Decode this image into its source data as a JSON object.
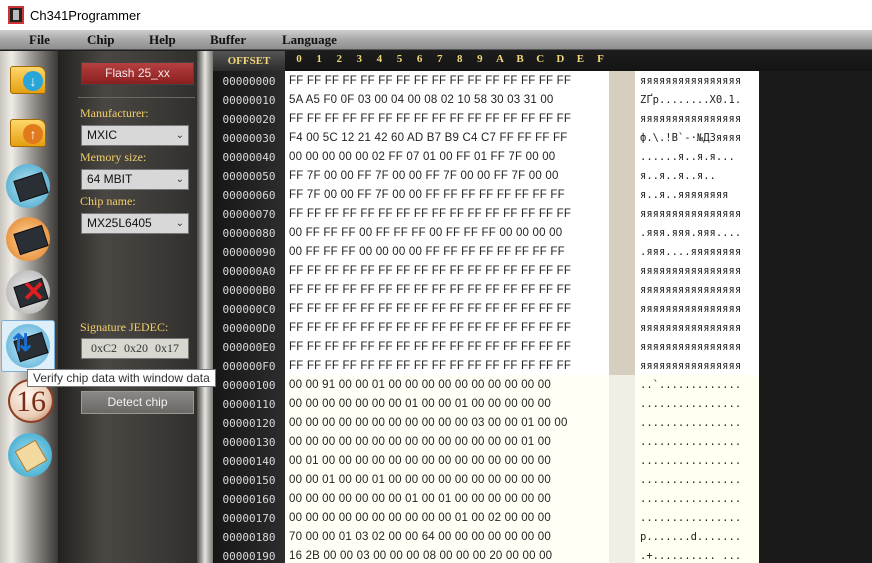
{
  "window": {
    "title": "Ch341Programmer"
  },
  "menu": [
    "File",
    "Chip",
    "Help",
    "Buffer",
    "Language"
  ],
  "rail": {
    "items": [
      {
        "name": "open-file-icon"
      },
      {
        "name": "save-file-icon"
      },
      {
        "name": "read-chip-icon"
      },
      {
        "name": "write-chip-icon"
      },
      {
        "name": "erase-chip-icon"
      },
      {
        "name": "verify-chip-icon"
      },
      {
        "name": "hex-16-icon",
        "text": "16"
      },
      {
        "name": "scroll-icon"
      }
    ]
  },
  "panel": {
    "flash_button": "Flash 25_xx",
    "manufacturer_label": "Manufacturer:",
    "manufacturer_value": "MXIC",
    "memory_label": "Memory size:",
    "memory_value": "64 MBIT",
    "chip_label": "Chip name:",
    "chip_value": "MX25L6405",
    "signature_label": "Signature JEDEC:",
    "signature_value": "0xC2 0x20 0x17",
    "detect_button": "Detect chip"
  },
  "tooltip": "Verify chip data with window data",
  "hex": {
    "offset_header": "OFFSET",
    "columns": [
      "0",
      "1",
      "2",
      "3",
      "4",
      "5",
      "6",
      "7",
      "8",
      "9",
      "A",
      "B",
      "C",
      "D",
      "E",
      "F"
    ],
    "rows": [
      {
        "offset": "00000000",
        "bytes": "FF FF FF FF FF FF FF FF FF FF FF FF FF FF FF FF",
        "ascii": "яяяяяяяяяяяяяяяя"
      },
      {
        "offset": "00000010",
        "bytes": "5A A5 F0 0F 03 00 04 00 08 02 10 58 30 03 31 00",
        "ascii": "ZҐр........X0.1."
      },
      {
        "offset": "00000020",
        "bytes": "FF FF FF FF FF FF FF FF FF FF FF FF FF FF FF FF",
        "ascii": "яяяяяяяяяяяяяяяя"
      },
      {
        "offset": "00000030",
        "bytes": "F4 00 5C 12 21 42 60 AD B7 B9 C4 C7 FF FF FF FF",
        "ascii": "ф.\\.!B`-·№ДЗяяяя"
      },
      {
        "offset": "00000040",
        "bytes": "00 00 00 00 00 02 FF 07 01 00 FF 01 FF 7F 00 00",
        "ascii": "......я..я.я..."
      },
      {
        "offset": "00000050",
        "bytes": "FF 7F 00 00 FF 7F 00 00 FF 7F 00 00 FF 7F 00 00",
        "ascii": "я..я..я..я.."
      },
      {
        "offset": "00000060",
        "bytes": "FF 7F 00 00 FF 7F 00 00 FF FF FF FF FF FF FF FF",
        "ascii": "я..я..яяяяяяяя"
      },
      {
        "offset": "00000070",
        "bytes": "FF FF FF FF FF FF FF FF FF FF FF FF FF FF FF FF",
        "ascii": "яяяяяяяяяяяяяяяя"
      },
      {
        "offset": "00000080",
        "bytes": "00 FF FF FF 00 FF FF FF 00 FF FF FF 00 00 00 00",
        "ascii": ".яяя.яяя.яяя...."
      },
      {
        "offset": "00000090",
        "bytes": "00 FF FF FF 00 00 00 00 FF FF FF FF FF FF FF FF",
        "ascii": ".яяя....яяяяяяяя"
      },
      {
        "offset": "000000A0",
        "bytes": "FF FF FF FF FF FF FF FF FF FF FF FF FF FF FF FF",
        "ascii": "яяяяяяяяяяяяяяяя"
      },
      {
        "offset": "000000B0",
        "bytes": "FF FF FF FF FF FF FF FF FF FF FF FF FF FF FF FF",
        "ascii": "яяяяяяяяяяяяяяяя"
      },
      {
        "offset": "000000C0",
        "bytes": "FF FF FF FF FF FF FF FF FF FF FF FF FF FF FF FF",
        "ascii": "яяяяяяяяяяяяяяяя"
      },
      {
        "offset": "000000D0",
        "bytes": "FF FF FF FF FF FF FF FF FF FF FF FF FF FF FF FF",
        "ascii": "яяяяяяяяяяяяяяяя"
      },
      {
        "offset": "000000E0",
        "bytes": "FF FF FF FF FF FF FF FF FF FF FF FF FF FF FF FF",
        "ascii": "яяяяяяяяяяяяяяяя"
      },
      {
        "offset": "000000F0",
        "bytes": "FF FF FF FF FF FF FF FF FF FF FF FF FF FF FF FF",
        "ascii": "яяяяяяяяяяяяяяяя"
      },
      {
        "offset": "00000100",
        "bytes": "00 00 91 00 00 01 00 00 00 00 00 00 00 00 00 00",
        "ascii": "..`............."
      },
      {
        "offset": "00000110",
        "bytes": "00 00 00 00 00 00 00 01 00 00 01 00 00 00 00 00",
        "ascii": "................"
      },
      {
        "offset": "00000120",
        "bytes": "00 00 00 00 00 00 00 00 00 00 00 03 00 00 01 00 00",
        "ascii": "................"
      },
      {
        "offset": "00000130",
        "bytes": "00 00 00 00 00 00 00 00 00 00 00 00 00 00 01 00",
        "ascii": "................"
      },
      {
        "offset": "00000140",
        "bytes": "00 01 00 00 00 00 00 00 00 00 00 00 00 00 00 00",
        "ascii": "................"
      },
      {
        "offset": "00000150",
        "bytes": "00 00 01 00 00 01 00 00 00 00 00 00 00 00 00 00",
        "ascii": "................"
      },
      {
        "offset": "00000160",
        "bytes": "00 00 00 00 00 00 00 01 00 01 00 00 00 00 00 00",
        "ascii": "................"
      },
      {
        "offset": "00000170",
        "bytes": "00 00 00 00 00 00 00 00 00 00 01 00 02 00 00 00",
        "ascii": "................"
      },
      {
        "offset": "00000180",
        "bytes": "70 00 00 01 03 02 00 00 64 00 00 00 00 00 00 00",
        "ascii": "p.......d......."
      },
      {
        "offset": "00000190",
        "bytes": "16 2B 00 00 03 00 00 00 08 00 00 00 20 00 00 00",
        "ascii": ".+.......... ..."
      }
    ]
  },
  "colors": {
    "label_yellow": "#f3cf6b",
    "flash_button": "#a83232",
    "hex_background": "#fffff5"
  }
}
